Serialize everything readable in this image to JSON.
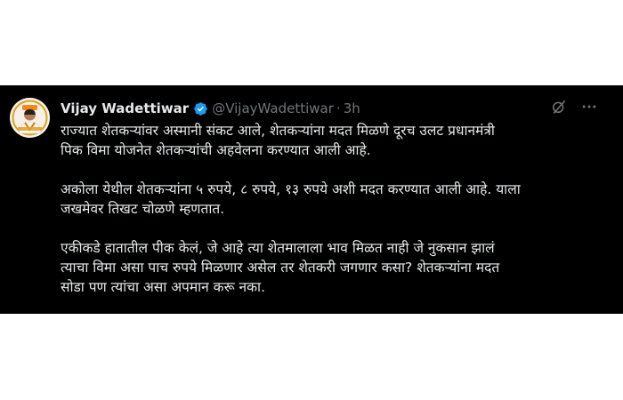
{
  "tweet": {
    "display_name": "Vijay Wadettiwar",
    "handle": "@VijayWadettiwar",
    "separator": "·",
    "time": "3h",
    "verified_icon": "verified-badge-icon",
    "colors": {
      "background": "#000000",
      "text": "#e7e9ea",
      "muted": "#71767b",
      "verified": "#1d9bf0"
    },
    "paragraphs": [
      {
        "lines": [
          "राज्यात शेतकऱ्यांवर अस्मानी संकट आले, शेतकऱ्यांना मदत मिळणे दूरच उलट प्रधानमंत्री",
          "पिक विमा योजनेत शेतकऱ्यांची अहवेलना करण्यात आली आहे."
        ]
      },
      {
        "lines": [
          "अकोला येथील शेतकऱ्यांना ५ रुपये, ८ रुपये, १३ रुपये अशी मदत करण्यात आली आहे. याला",
          "जखमेवर तिखट चोळणे म्हणतात."
        ]
      },
      {
        "lines": [
          "एकीकडे हातातील पीक केलं, जे आहे त्या शेतमालाला भाव मिळत नाही जे नुकसान झालं",
          "त्याचा विमा असा पाच रुपये मिळणार असेल तर शेतकरी जगणार कसा? शेतकऱ्यांना मदत",
          "सोडा पण त्यांचा असा अपमान करू नका."
        ]
      }
    ]
  }
}
